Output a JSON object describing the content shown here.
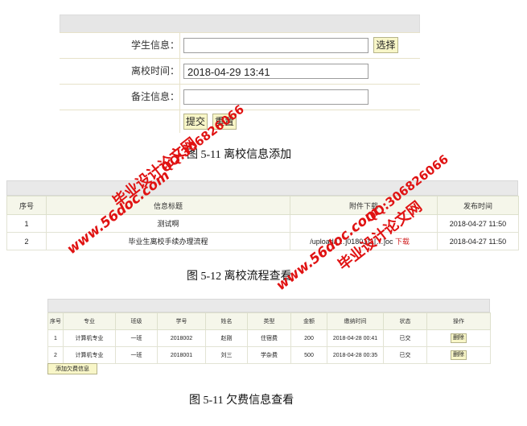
{
  "form": {
    "student_label": "学生信息：",
    "student_value": "",
    "select_button": "选择",
    "leave_time_label": "离校时间：",
    "leave_time_value": "2018-04-29 13:41",
    "remark_label": "备注信息：",
    "remark_value": "",
    "submit_button": "提交",
    "reset_button": "重置"
  },
  "caption1": "图 5-11  离校信息添加",
  "process_table": {
    "headers": [
      "序号",
      "信息标题",
      "附件下载",
      "发布时间"
    ],
    "rows": [
      {
        "no": "1",
        "title": "测试啊",
        "attachment": "",
        "download": "",
        "time": "2018-04-27 11:50"
      },
      {
        "no": "2",
        "title": "毕业生离校手续办理流程",
        "attachment": "/upload/[…]0180111[…]oc",
        "download": "下载",
        "time": "2018-04-27 11:50"
      }
    ]
  },
  "caption2": "图 5-12  离校流程查看",
  "fee_table": {
    "headers": [
      "序号",
      "专业",
      "班级",
      "学号",
      "姓名",
      "类型",
      "金额",
      "缴纳时间",
      "状态",
      "操作"
    ],
    "rows": [
      {
        "no": "1",
        "major": "计算机专业",
        "class": "一班",
        "sid": "2018002",
        "name": "赵刚",
        "type": "住宿费",
        "amount": "200",
        "time": "2018-04-28 00:41",
        "status": "已交",
        "op": "删除"
      },
      {
        "no": "2",
        "major": "计算机专业",
        "class": "一班",
        "sid": "2018001",
        "name": "刘三",
        "type": "学杂费",
        "amount": "500",
        "time": "2018-04-28 00:35",
        "status": "已交",
        "op": "删除"
      }
    ],
    "add_button": "添加欠费信息"
  },
  "caption3": "图 5-11  欠费信息查看",
  "watermarks": {
    "url": "www.56doc.com",
    "qq": "QQ:306826066",
    "cn": "毕业设计论文网"
  }
}
